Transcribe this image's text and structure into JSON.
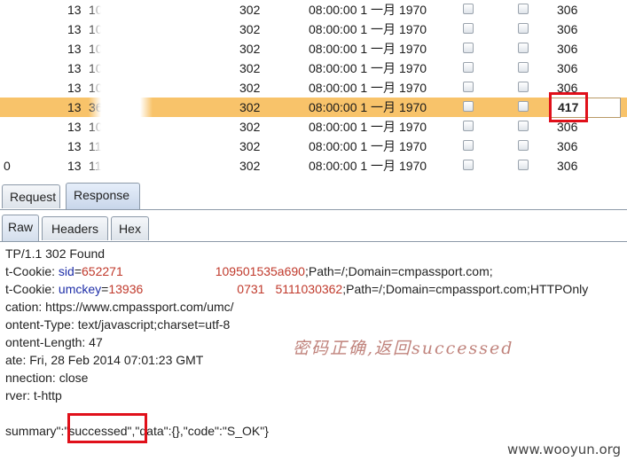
{
  "table": {
    "rows": [
      {
        "edge": "",
        "id": "13",
        "sub": "10",
        "status": "302",
        "date": "08:00:00 1 一月 1970",
        "length": "306",
        "selected": false
      },
      {
        "edge": "",
        "id": "13",
        "sub": "10",
        "status": "302",
        "date": "08:00:00 1 一月 1970",
        "length": "306",
        "selected": false
      },
      {
        "edge": "",
        "id": "13",
        "sub": "10",
        "status": "302",
        "date": "08:00:00 1 一月 1970",
        "length": "306",
        "selected": false
      },
      {
        "edge": "",
        "id": "13",
        "sub": "10",
        "status": "302",
        "date": "08:00:00 1 一月 1970",
        "length": "306",
        "selected": false
      },
      {
        "edge": "",
        "id": "13",
        "sub": "10",
        "status": "302",
        "date": "08:00:00 1 一月 1970",
        "length": "306",
        "selected": false
      },
      {
        "edge": "",
        "id": "13",
        "sub": "36",
        "status": "302",
        "date": "08:00:00 1 一月 1970",
        "length": "417",
        "selected": true
      },
      {
        "edge": "",
        "id": "13",
        "sub": "10",
        "status": "302",
        "date": "08:00:00 1 一月 1970",
        "length": "306",
        "selected": false
      },
      {
        "edge": "",
        "id": "13",
        "sub": "11",
        "status": "302",
        "date": "08:00:00 1 一月 1970",
        "length": "306",
        "selected": false
      },
      {
        "edge": "0",
        "id": "13",
        "sub": "11",
        "status": "302",
        "date": "08:00:00 1 一月 1970",
        "length": "306",
        "selected": false
      }
    ]
  },
  "tabs": {
    "request": "Request",
    "response": "Response"
  },
  "subtabs": {
    "raw": "Raw",
    "headers": "Headers",
    "hex": "Hex"
  },
  "response": {
    "status_line": "TP/1.1 302 Found",
    "cookie1_prefix": "t-Cookie: ",
    "cookie1_name": "sid",
    "cookie1_eq": "=",
    "cookie1_value_start": "652271",
    "cookie1_value_end": "109501535a690",
    "cookie1_attrs": ";Path=/;Domain=cmpassport.com;",
    "cookie2_prefix": "t-Cookie: ",
    "cookie2_name": "umckey",
    "cookie2_eq": "=",
    "cookie2_value_start": "13936",
    "cookie2_value_mid": "0731",
    "cookie2_value_end": "5111030362",
    "cookie2_attrs": ";Path=/;Domain=cmpassport.com;HTTPOnly",
    "location": "cation: https://www.cmpassport.com/umc/",
    "content_type": "ontent-Type: text/javascript;charset=utf-8",
    "content_length": "ontent-Length: 47",
    "date": "ate: Fri, 28 Feb 2014 07:01:23 GMT",
    "connection": "nnection: close",
    "server": "rver: t-http",
    "body_prefix": "summary\":",
    "body_value": "\"successed\"",
    "body_suffix": ",\"data\":{},\"code\":\"S_OK\"}"
  },
  "annotation": "密码正确,返回successed",
  "watermark": "www.wooyun.org",
  "colors": {
    "selected_row": "#f8c36a",
    "highlight": "#e0101a",
    "cookie_name": "#1f2fa8",
    "cookie_value": "#c0392b",
    "annotation": "#c0837c"
  }
}
